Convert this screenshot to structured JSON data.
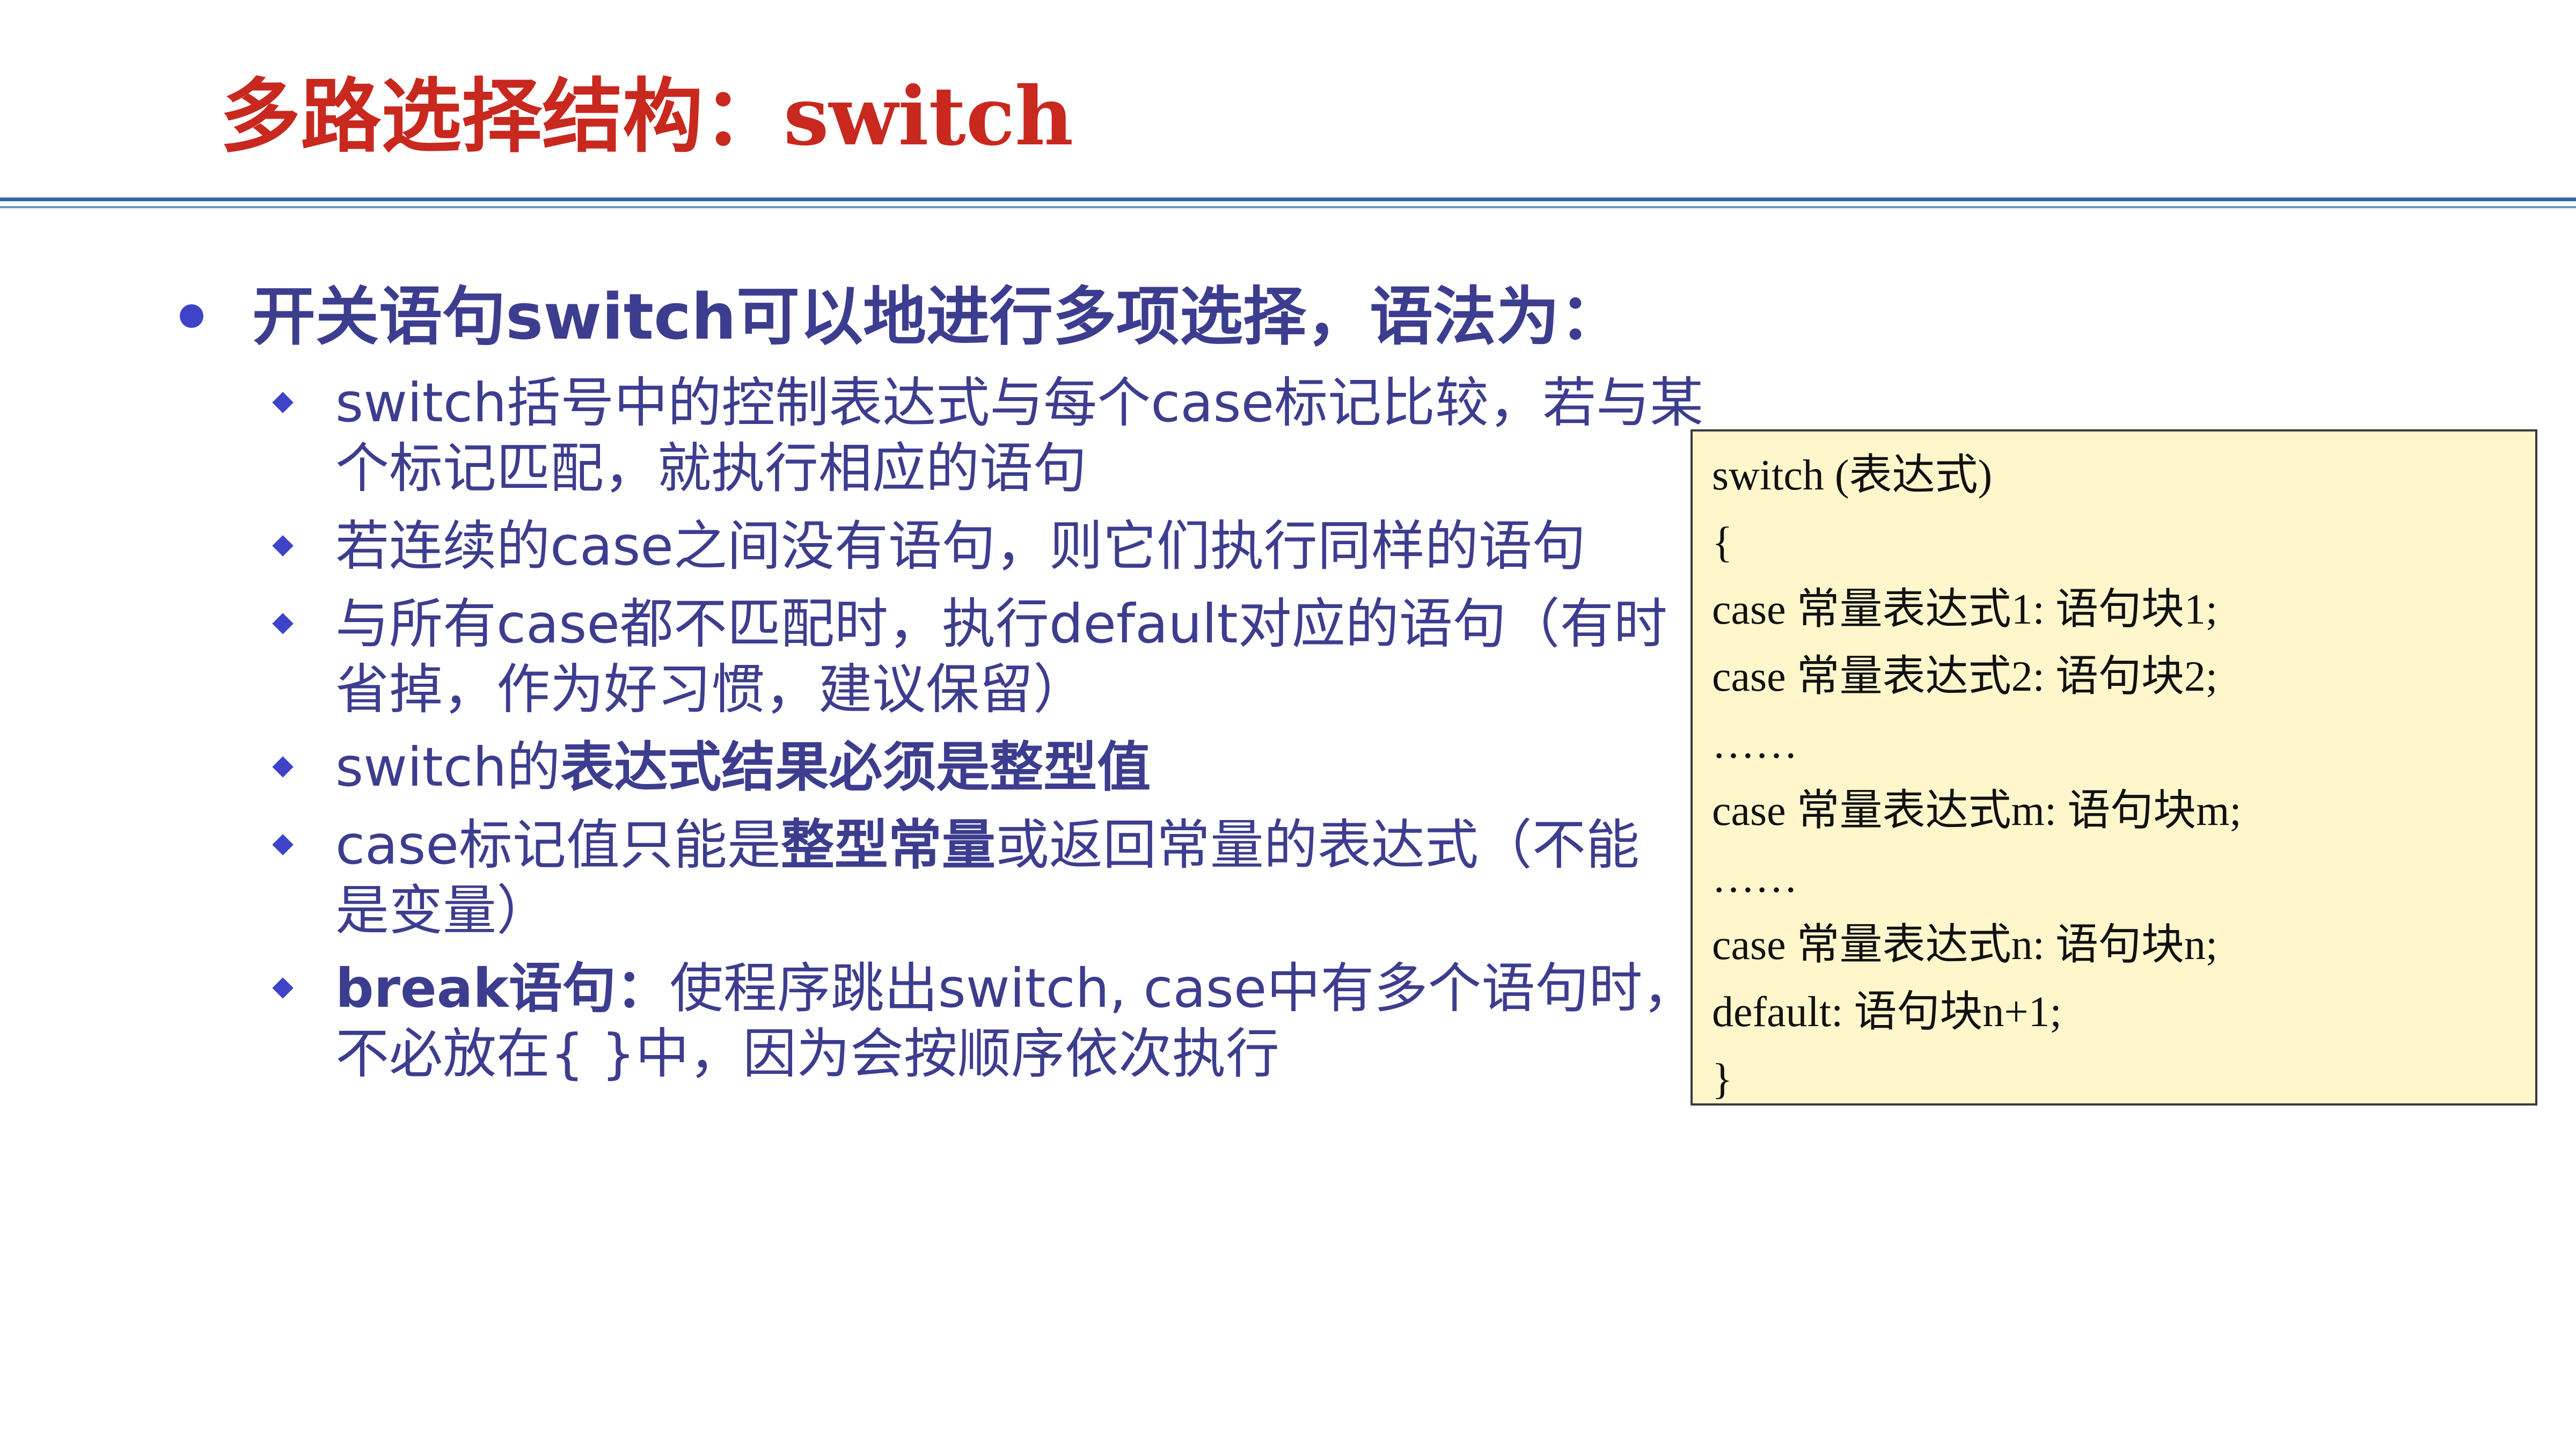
{
  "slide": {
    "title": "多路选择结构：switch",
    "main_point": "开关语句switch可以地进行多项选择，语法为：",
    "sub_points": [
      {
        "lines": [
          "switch括号中的控制表达式与每个case标记比较，若与某",
          "个标记匹配，就执行相应的语句"
        ]
      },
      {
        "lines": [
          "若连续的case之间没有语句，则它们执行同样的语句"
        ]
      },
      {
        "lines": [
          "与所有case都不匹配时，执行default对应的语句（有时",
          "省掉，作为好习惯，建议保留）"
        ]
      },
      {
        "prefix": "switch的",
        "bold": "表达式结果必须是整型值"
      },
      {
        "prefix": "case标记值只能是",
        "bold": "整型常量",
        "suffix": "或返回常量的表达式（不能",
        "line2": "是变量）"
      },
      {
        "bold": "break语句：",
        "suffix": "使程序跳出switch, case中有多个语句时，",
        "line2": "不必放在{ }中，因为会按顺序依次执行"
      }
    ],
    "code_lines": [
      "switch (表达式)",
      "{",
      "case 常量表达式1: 语句块1;",
      "case 常量表达式2: 语句块2;",
      "……",
      "case 常量表达式m: 语句块m;",
      "……",
      "case 常量表达式n: 语句块n;",
      "default: 语句块n+1;",
      "}"
    ],
    "colors": {
      "title": "#c8281e",
      "body_text": "#3d3d8f",
      "bullet": "#3f43c8",
      "rule": "#2f6aa8",
      "code_background": "#fff6cc"
    }
  }
}
